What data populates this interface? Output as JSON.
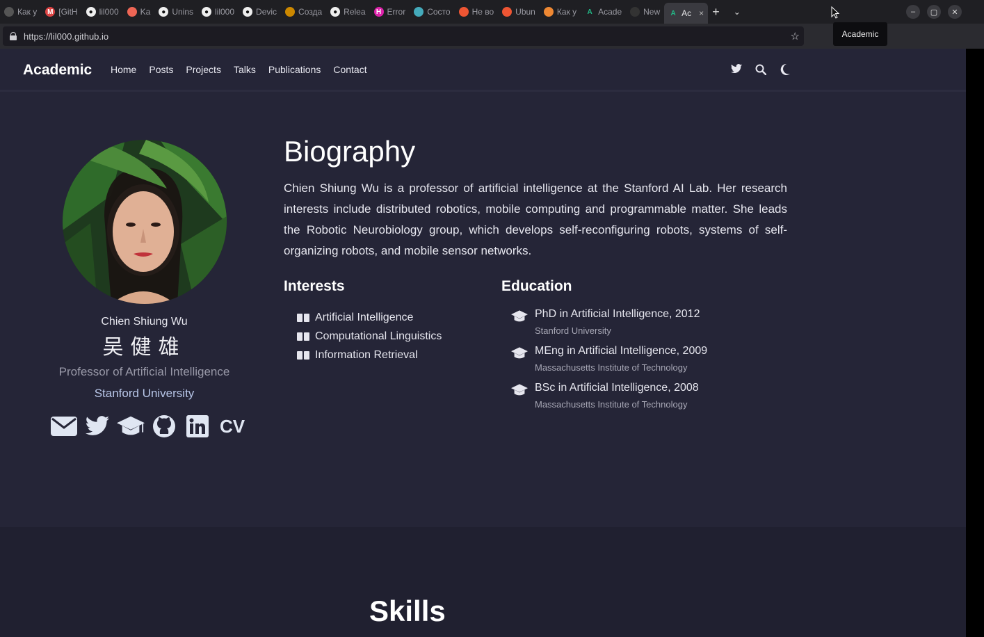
{
  "browser": {
    "tabs": [
      {
        "label": "Как у",
        "color": "#555"
      },
      {
        "label": "[GitH",
        "color": "#d44"
      },
      {
        "label": "lil000",
        "color": "#222"
      },
      {
        "label": "Ka",
        "color": "#e65"
      },
      {
        "label": "Unins",
        "color": "#222"
      },
      {
        "label": "lil000",
        "color": "#222"
      },
      {
        "label": "Devic",
        "color": "#222"
      },
      {
        "label": "Созда",
        "color": "#c80"
      },
      {
        "label": "Relea",
        "color": "#222"
      },
      {
        "label": "Error",
        "color": "#d2a"
      },
      {
        "label": "Состо",
        "color": "#4ab"
      },
      {
        "label": "He во",
        "color": "#e53"
      },
      {
        "label": "Ubun",
        "color": "#e53"
      },
      {
        "label": "Как у",
        "color": "#e83"
      },
      {
        "label": "Acade",
        "color": "#2b8"
      },
      {
        "label": "New",
        "color": "#333"
      }
    ],
    "active_tab": "Ac",
    "active_tab_close": "×",
    "new_tab": "+",
    "tab_list": "⌄",
    "window_buttons": [
      "–",
      "▢",
      "✕"
    ],
    "url": "https://lil000.github.io",
    "tooltip": "Academic"
  },
  "site": {
    "brand": "Academic",
    "nav": [
      "Home",
      "Posts",
      "Projects",
      "Talks",
      "Publications",
      "Contact"
    ],
    "profile": {
      "name": "Chien Shiung Wu",
      "name_cjk": "吴健雄",
      "role": "Professor of Artificial Intelligence",
      "org": "Stanford University",
      "cv": "CV"
    },
    "biography": {
      "heading": "Biography",
      "text": "Chien Shiung Wu is a professor of artificial intelligence at the Stanford AI Lab. Her research interests include distributed robotics, mobile computing and programmable matter. She leads the Robotic Neurobiology group, which develops self-reconfiguring robots, systems of self-organizing robots, and mobile sensor networks."
    },
    "interests": {
      "heading": "Interests",
      "items": [
        "Artificial Intelligence",
        "Computational Linguistics",
        "Information Retrieval"
      ]
    },
    "education": {
      "heading": "Education",
      "items": [
        {
          "degree": "PhD in Artificial Intelligence, 2012",
          "institution": "Stanford University"
        },
        {
          "degree": "MEng in Artificial Intelligence, 2009",
          "institution": "Massachusetts Institute of Technology"
        },
        {
          "degree": "BSc in Artificial Intelligence, 2008",
          "institution": "Massachusetts Institute of Technology"
        }
      ]
    },
    "skills_heading": "Skills"
  }
}
